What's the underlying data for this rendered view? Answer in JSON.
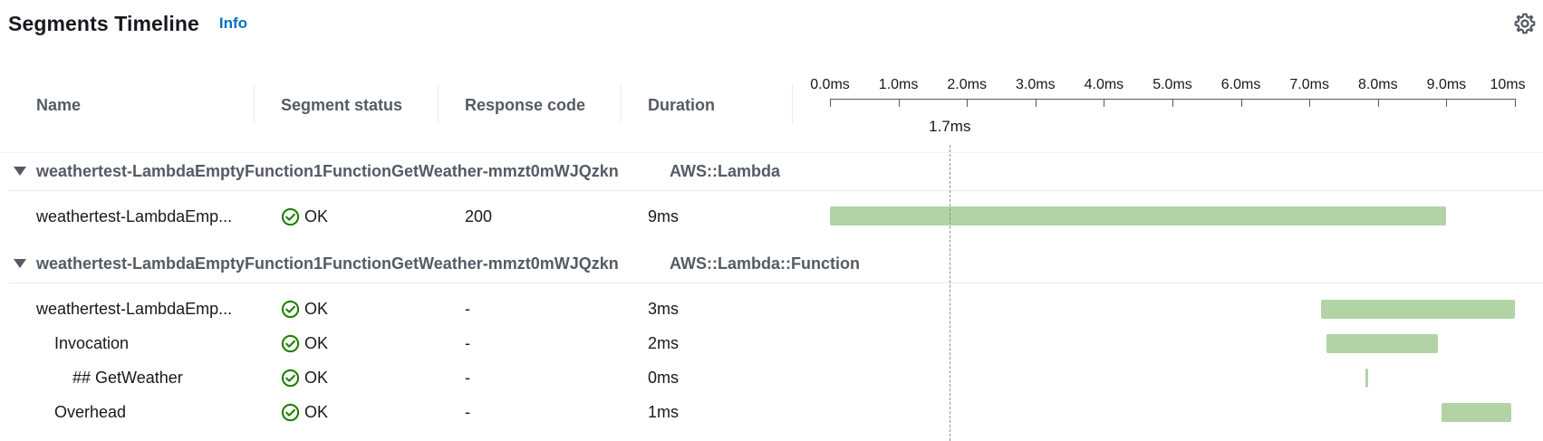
{
  "header": {
    "title": "Segments Timeline",
    "info_label": "Info",
    "settings_icon": "gear-icon"
  },
  "columns": {
    "name": "Name",
    "status": "Segment status",
    "response": "Response code",
    "duration": "Duration"
  },
  "axis": {
    "unit": "ms",
    "min_ms": 0,
    "max_ms": 10,
    "ticks": [
      "0.0ms",
      "1.0ms",
      "2.0ms",
      "3.0ms",
      "4.0ms",
      "5.0ms",
      "6.0ms",
      "7.0ms",
      "8.0ms",
      "9.0ms",
      "10ms"
    ],
    "marker_ms": 1.75,
    "marker_label": "1.7ms"
  },
  "groups": [
    {
      "name": "weathertest-LambdaEmptyFunction1FunctionGetWeather-mmzt0mWJQzkn",
      "type": "AWS::Lambda",
      "segments": [
        {
          "name": "weathertest-LambdaEmp...",
          "status": "OK",
          "response_code": "200",
          "duration": "9ms",
          "start_ms": 0.0,
          "end_ms": 9.0
        }
      ]
    },
    {
      "name": "weathertest-LambdaEmptyFunction1FunctionGetWeather-mmzt0mWJQzkn",
      "type": "AWS::Lambda::Function",
      "segments": [
        {
          "name": "weathertest-LambdaEmp...",
          "status": "OK",
          "response_code": "-",
          "duration": "3ms",
          "start_ms": 7.17,
          "end_ms": 10.0
        },
        {
          "name": "Invocation",
          "status": "OK",
          "response_code": "-",
          "duration": "2ms",
          "start_ms": 7.25,
          "end_ms": 8.87
        },
        {
          "name": "## GetWeather",
          "status": "OK",
          "response_code": "-",
          "duration": "0ms",
          "start_ms": 7.82,
          "end_ms": 7.85
        },
        {
          "name": "Overhead",
          "status": "OK",
          "response_code": "-",
          "duration": "1ms",
          "start_ms": 8.93,
          "end_ms": 9.95
        }
      ]
    }
  ],
  "colors": {
    "bar": "#b2d4a5",
    "ok": "#1d8102",
    "link": "#0073bb"
  }
}
